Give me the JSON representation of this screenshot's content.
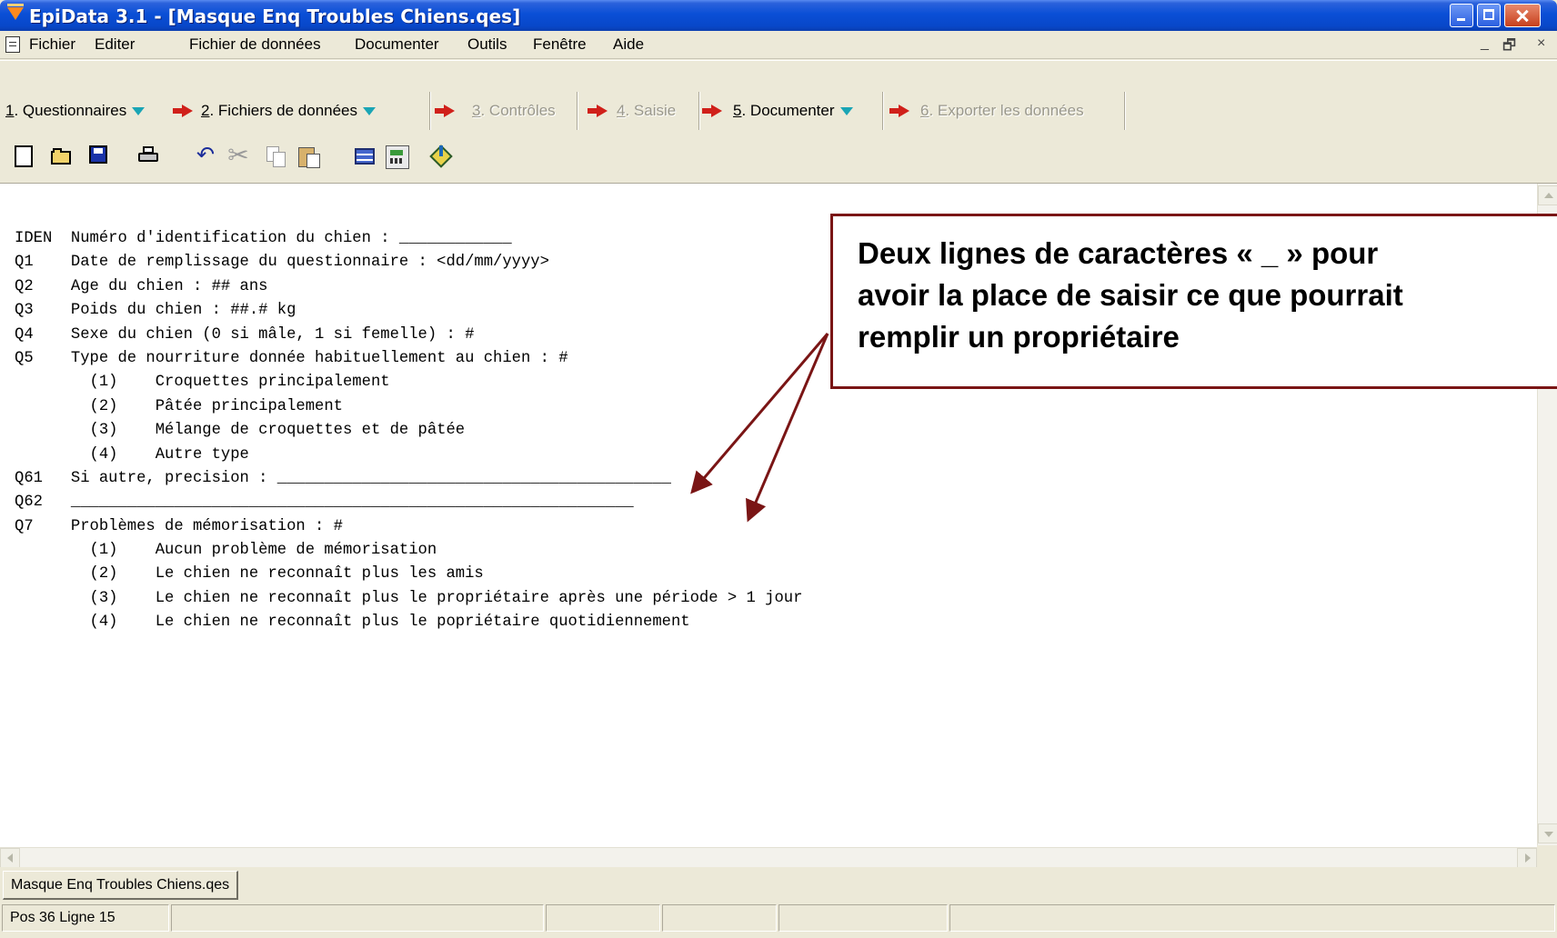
{
  "window": {
    "title": "EpiData 3.1 - [Masque Enq Troubles Chiens.qes]"
  },
  "menu": [
    "Fichier",
    "Editer",
    "Fichier de données",
    "Documenter",
    "Outils",
    "Fenêtre",
    "Aide"
  ],
  "mdi_controls": [
    "_",
    "🗗",
    "×"
  ],
  "workflow": [
    {
      "num": "1",
      "label": ". Questionnaires",
      "enabled": true,
      "dropdown": true
    },
    {
      "num": "2",
      "label": ". Fichiers de données",
      "enabled": true,
      "dropdown": true
    },
    {
      "num": "3",
      "label": ". Contrôles",
      "enabled": false,
      "dropdown": false
    },
    {
      "num": "4",
      "label": ". Saisie",
      "enabled": false,
      "dropdown": false
    },
    {
      "num": "5",
      "label": ". Documenter",
      "enabled": true,
      "dropdown": true
    },
    {
      "num": "6",
      "label": ". Exporter les données",
      "enabled": false,
      "dropdown": false
    }
  ],
  "toolbar_icons": [
    "new-file-icon",
    "open-folder-icon",
    "save-icon",
    "print-icon",
    "undo-icon",
    "cut-icon",
    "copy-icon",
    "paste-icon",
    "table-icon",
    "calculator-icon",
    "brush-icon"
  ],
  "editor": {
    "lines": [
      "IDEN  Numéro d'identification du chien : ____________",
      "Q1    Date de remplissage du questionnaire : <dd/mm/yyyy>",
      "Q2    Age du chien : ## ans",
      "Q3    Poids du chien : ##.# kg",
      "Q4    Sexe du chien (0 si mâle, 1 si femelle) : #",
      "Q5    Type de nourriture donnée habituellement au chien : #",
      "        (1)    Croquettes principalement",
      "        (2)    Pâtée principalement",
      "        (3)    Mélange de croquettes et de pâtée",
      "        (4)    Autre type",
      "Q61   Si autre, precision : __________________________________________",
      "Q62   ____________________________________________________________",
      "Q7    Problèmes de mémorisation : #",
      "        (1)    Aucun problème de mémorisation",
      "        (2)    Le chien ne reconnaît plus les amis",
      "        (3)    Le chien ne reconnaît plus le propriétaire après une période > 1 jour",
      "        (4)    Le chien ne reconnaît plus le popriétaire quotidiennement"
    ]
  },
  "annotation": {
    "text": "Deux lignes de caractères « _ » pour\navoir la place de saisir ce que pourrait\nremplir un propriétaire",
    "border_color": "#7a1515"
  },
  "tab": {
    "label": "Masque Enq Troubles Chiens.qes"
  },
  "status": {
    "position": "Pos 36  Ligne 15"
  },
  "colors": {
    "titlebar": "#0a4fd6",
    "workflow_arrow": "#d0201a",
    "dropdown_triangle": "#1aa5b5",
    "chrome": "#ece9d8"
  }
}
